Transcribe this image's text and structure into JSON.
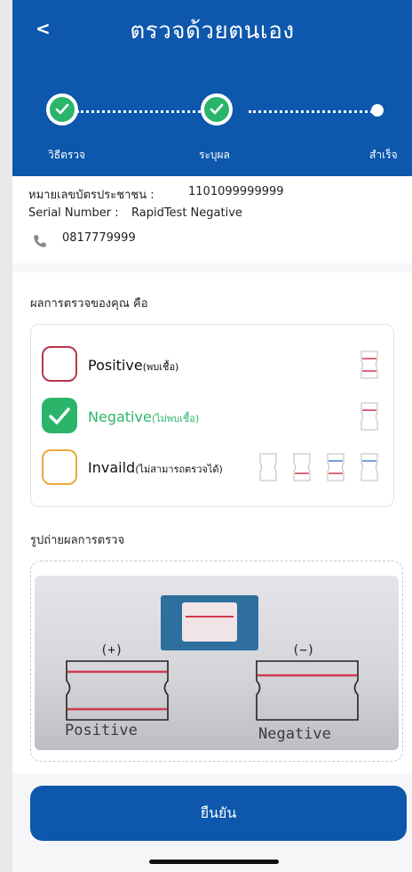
{
  "header": {
    "back_icon": "chevron-left-icon",
    "back_glyph": "<",
    "title": "ตรวจด้วยตนเอง",
    "bg_color": "#0d57ad"
  },
  "stepper": {
    "steps": [
      {
        "label": "วิธีตรวจ",
        "state": "done"
      },
      {
        "label": "ระบุผล",
        "state": "done"
      },
      {
        "label": "สำเร็จ",
        "state": "pending"
      }
    ],
    "done_color": "#2ab56a"
  },
  "info": {
    "id_label": "หมายเลขบัตรประชาชน :",
    "id_value": "1101099999999",
    "serial_label": "Serial Number :",
    "serial_value": "RapidTest Negative",
    "phone": "0817779999"
  },
  "result": {
    "heading": "ผลการตรวจของคุณ คือ",
    "options": [
      {
        "label": "Positive",
        "sub": "(พบเชื้อ)",
        "checked": false,
        "color": "#b3374a"
      },
      {
        "label": "Negative",
        "sub": "(ไม่พบเชื้อ)",
        "checked": true,
        "color": "#2ab56a"
      },
      {
        "label": "Invaild",
        "sub": "(ไม่สามารถตรวจได้)",
        "checked": false,
        "color": "#e8a93a"
      }
    ]
  },
  "photo": {
    "heading": "รูปถ่ายผลการตรวจ",
    "positive_sign": "(+)",
    "negative_sign": "(−)",
    "positive_label": "Positive",
    "negative_label": "Negative"
  },
  "confirm_label": "ยืนยัน"
}
